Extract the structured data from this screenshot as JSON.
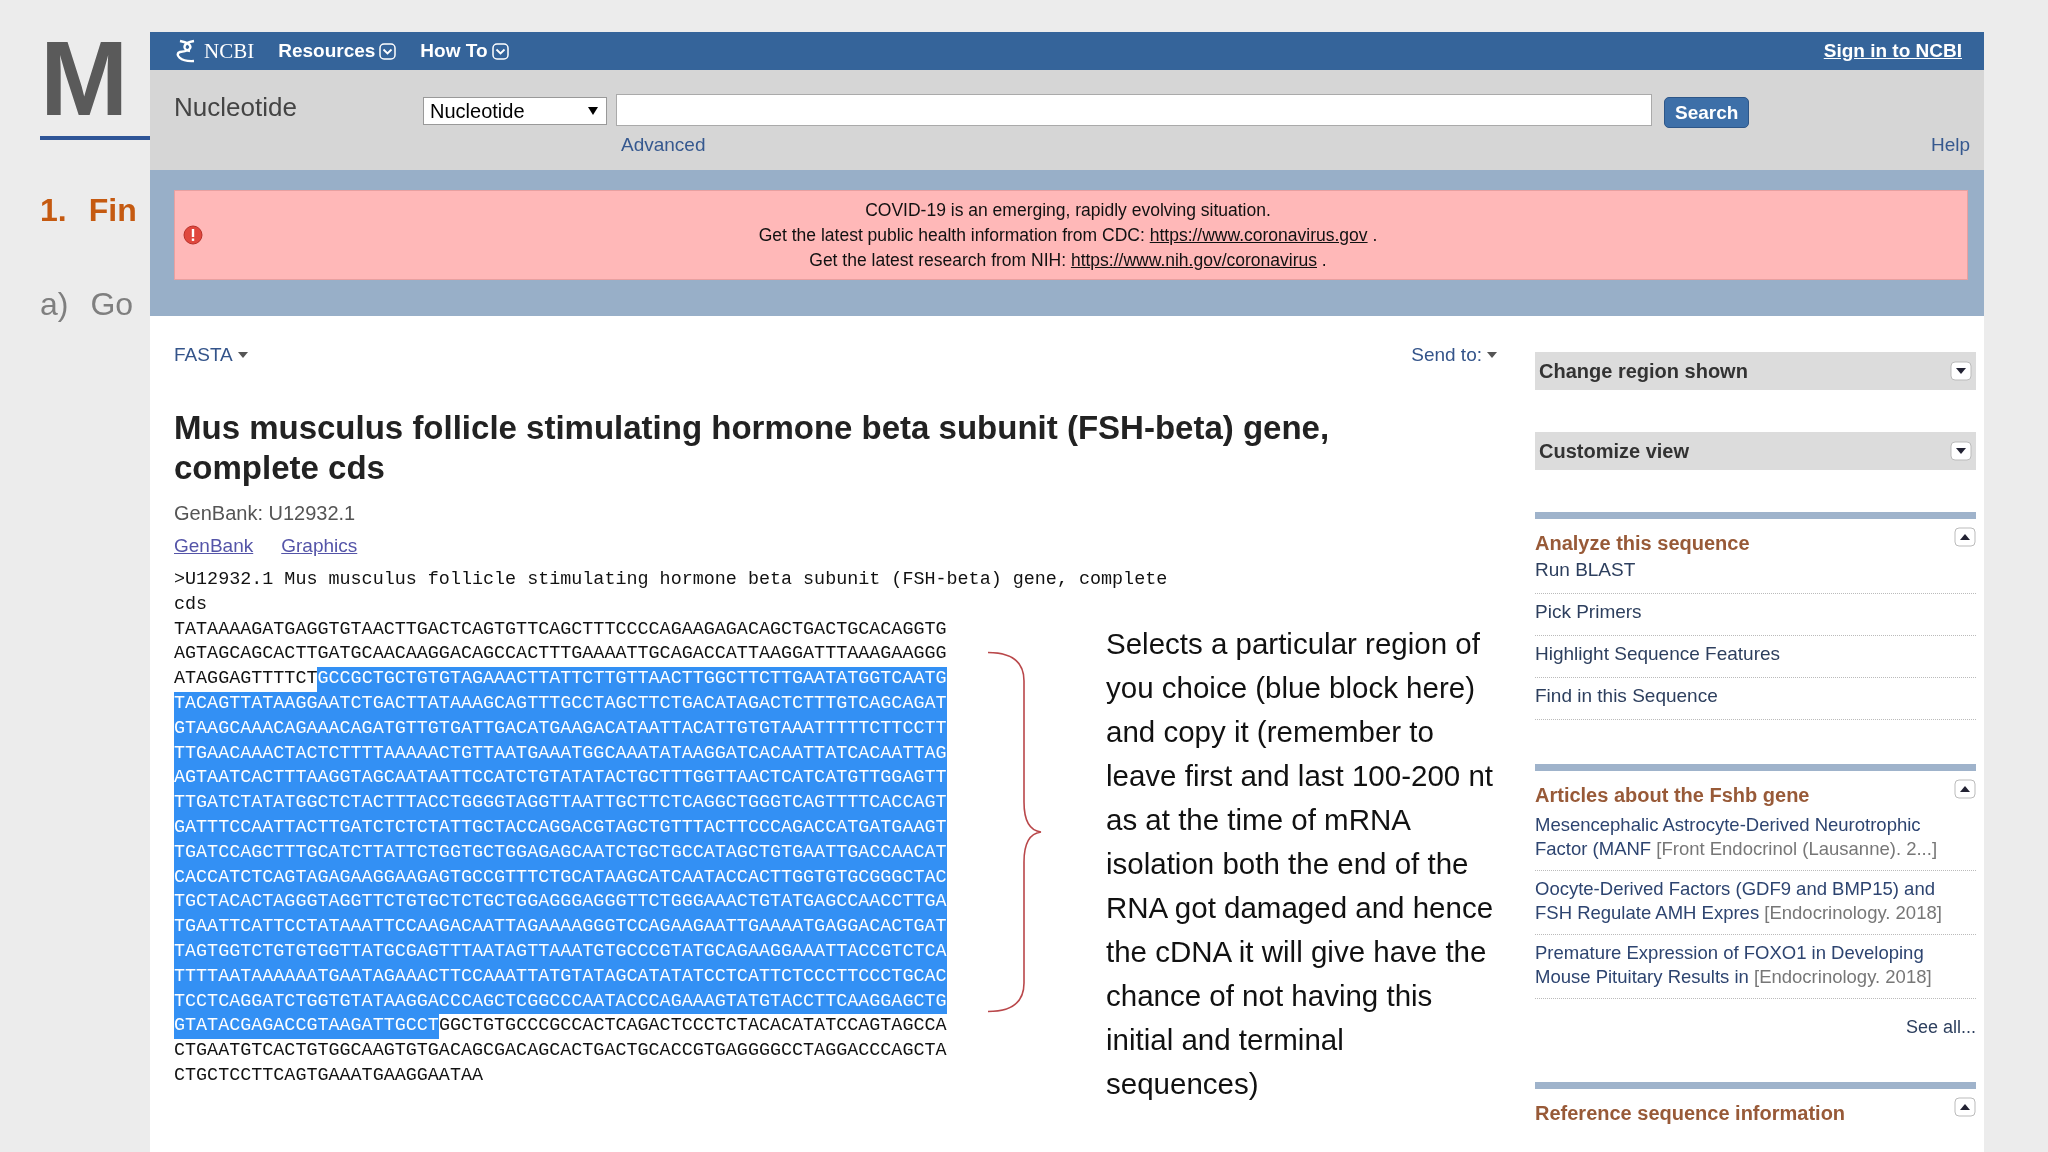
{
  "slide": {
    "title": "M",
    "items": [
      {
        "number": "1.",
        "text": "Fin",
        "kind": "main"
      },
      {
        "number": "a)",
        "text": "Go",
        "kind": "sub"
      }
    ]
  },
  "ncbi": {
    "topbar": {
      "logo": "NCBI",
      "menus": [
        "Resources",
        "How To"
      ],
      "sign_in": "Sign in to NCBI"
    },
    "search": {
      "database_label": "Nucleotide",
      "database_select": "Nucleotide",
      "button": "Search",
      "advanced": "Advanced",
      "help": "Help"
    },
    "alert": {
      "lines": [
        {
          "text": "COVID-19 is an emerging, rapidly evolving situation."
        },
        {
          "text": "Get the latest public health information from CDC:",
          "link": "https://www.coronavirus.gov",
          "after": "."
        },
        {
          "text": "Get the latest research from NIH:",
          "link": "https://www.nih.gov/coronavirus",
          "after": "."
        }
      ]
    },
    "record": {
      "format": "FASTA",
      "send_to": "Send to:",
      "title": "Mus musculus follicle stimulating hormone beta subunit (FSH-beta) gene, complete cds",
      "accession": "GenBank: U12932.1",
      "links": [
        "GenBank",
        "Graphics"
      ],
      "fasta_header": ">U12932.1 Mus musculus follicle stimulating hormone beta subunit (FSH-beta) gene, complete cds",
      "sequence": [
        {
          "segments": [
            {
              "text": "TATAAAAGATGAGGTGTAACTTGACTCAGTGTTCAGCTTTCCCCAGAAGAGACAGCTGACTGCACAGGTG",
              "selected": false
            }
          ]
        },
        {
          "segments": [
            {
              "text": "AGTAGCAGCACTTGATGCAACAAGGACAGCCACTTTGAAAATTGCAGACCATTAAGGATTTAAAGAAGGG",
              "selected": false
            }
          ]
        },
        {
          "segments": [
            {
              "text": "ATAGGAGTTTTCT",
              "selected": false
            },
            {
              "text": "GCCGCTGCTGTGTAGAAACTTATTCTTGTTAACTTGGCTTCTTGAATATGGTCAATG",
              "selected": true
            }
          ]
        },
        {
          "segments": [
            {
              "text": "TACAGTTATAAGGAATCTGACTTATAAAGCAGTTTGCCTAGCTTCTGACATAGACTCTTTGTCAGCAGAT",
              "selected": true
            }
          ]
        },
        {
          "segments": [
            {
              "text": "GTAAGCAAACAGAAACAGATGTTGTGATTGACATGAAGACATAATTACATTGTGTAAATTTTTCTTCCTT",
              "selected": true
            }
          ]
        },
        {
          "segments": [
            {
              "text": "TTGAACAAACTACTCTTTTAAAAACTGTTAATGAAATGGCAAATATAAGGATCACAATTATCACAATTAG",
              "selected": true
            }
          ]
        },
        {
          "segments": [
            {
              "text": "AGTAATCACTTTAAGGTAGCAATAATTCCATCTGTATATACTGCTTTGGTTAACTCATCATGTTGGAGTT",
              "selected": true
            }
          ]
        },
        {
          "segments": [
            {
              "text": "TTGATCTATATGGCTCTACTTTACCTGGGGTAGGTTAATTGCTTCTCAGGCTGGGTCAGTTTTCACCAGT",
              "selected": true
            }
          ]
        },
        {
          "segments": [
            {
              "text": "GATTTCCAATTACTTGATCTCTCTATTGCTACCAGGACGTAGCTGTTTACTTCCCAGACCATGATGAAGT",
              "selected": true
            }
          ]
        },
        {
          "segments": [
            {
              "text": "TGATCCAGCTTTGCATCTTATTCTGGTGCTGGAGAGCAATCTGCTGCCATAGCTGTGAATTGACCAACAT",
              "selected": true
            }
          ]
        },
        {
          "segments": [
            {
              "text": "CACCATCTCAGTAGAGAAGGAAGAGTGCCGTTTCTGCATAAGCATCAATACCACTTGGTGTGCGGGCTAC",
              "selected": true
            }
          ]
        },
        {
          "segments": [
            {
              "text": "TGCTACACTAGGGTAGGTTCTGTGCTCTGCTGGAGGGAGGGTTCTGGGAAACTGTATGAGCCAACCTTGA",
              "selected": true
            }
          ]
        },
        {
          "segments": [
            {
              "text": "TGAATTCATTCCTATAAATTCCAAGACAATTAGAAAAGGGTCCAGAAGAATTGAAAATGAGGACACTGAT",
              "selected": true
            }
          ]
        },
        {
          "segments": [
            {
              "text": "TAGTGGTCTGTGTGGTTATGCGAGTTTAATAGTTAAATGTGCCCGTATGCAGAAGGAAATTACCGTCTCA",
              "selected": true
            }
          ]
        },
        {
          "segments": [
            {
              "text": "TTTTAATAAAAAATGAATAGAAACTTCCAAATTATGTATAGCATATATCCTCATTCTCCCTTCCCTGCAC",
              "selected": true
            }
          ]
        },
        {
          "segments": [
            {
              "text": "TCCTCAGGATCTGGTGTATAAGGACCCAGCTCGGCCCAATACCCAGAAAGTATGTACCTTCAAGGAGCTG",
              "selected": true
            }
          ]
        },
        {
          "segments": [
            {
              "text": "GTATACGAGACCGTAAGATTGCCT",
              "selected": true
            },
            {
              "text": "GGCTGTGCCCGCCACTCAGACTCCCTCTACACATATCCAGTAGCCA",
              "selected": false
            }
          ]
        },
        {
          "segments": [
            {
              "text": "CTGAATGTCACTGTGGCAAGTGTGACAGCGACAGCACTGACTGCACCGTGAGGGGCCTAGGACCCAGCTA",
              "selected": false
            }
          ]
        },
        {
          "segments": [
            {
              "text": "CTGCTCCTTCAGTGAAATGAAGGAATAA",
              "selected": false
            }
          ]
        }
      ]
    },
    "sidebar": {
      "sections": [
        {
          "title": "Change region shown",
          "expanded": false
        },
        {
          "title": "Customize view",
          "expanded": false
        },
        {
          "title": "Analyze this sequence",
          "expanded": true,
          "links": [
            "Run BLAST",
            "Pick Primers",
            "Highlight Sequence Features",
            "Find in this Sequence"
          ]
        },
        {
          "title": "Articles about the Fshb gene",
          "expanded": true,
          "articles": [
            {
              "title": "Mesencephalic Astrocyte-Derived Neurotrophic Factor (MANF",
              "source": "[Front Endocrinol (Lausanne). 2...]"
            },
            {
              "title": "Oocyte-Derived Factors (GDF9 and BMP15) and FSH Regulate AMH Expres",
              "source": "[Endocrinology. 2018]"
            },
            {
              "title": "Premature Expression of FOXO1 in Developing Mouse Pituitary Results in",
              "source": "[Endocrinology. 2018]"
            }
          ],
          "see_all": "See all..."
        },
        {
          "title": "Reference sequence information",
          "expanded": true
        }
      ]
    }
  },
  "note": "Selects a particular region of you choice (blue block here) and copy it (remember to leave first and last 100-200 nt as at the time of mRNA isolation both the end of the RNA got damaged and hence the cDNA it will give have the chance of not having this initial and terminal sequences)"
}
